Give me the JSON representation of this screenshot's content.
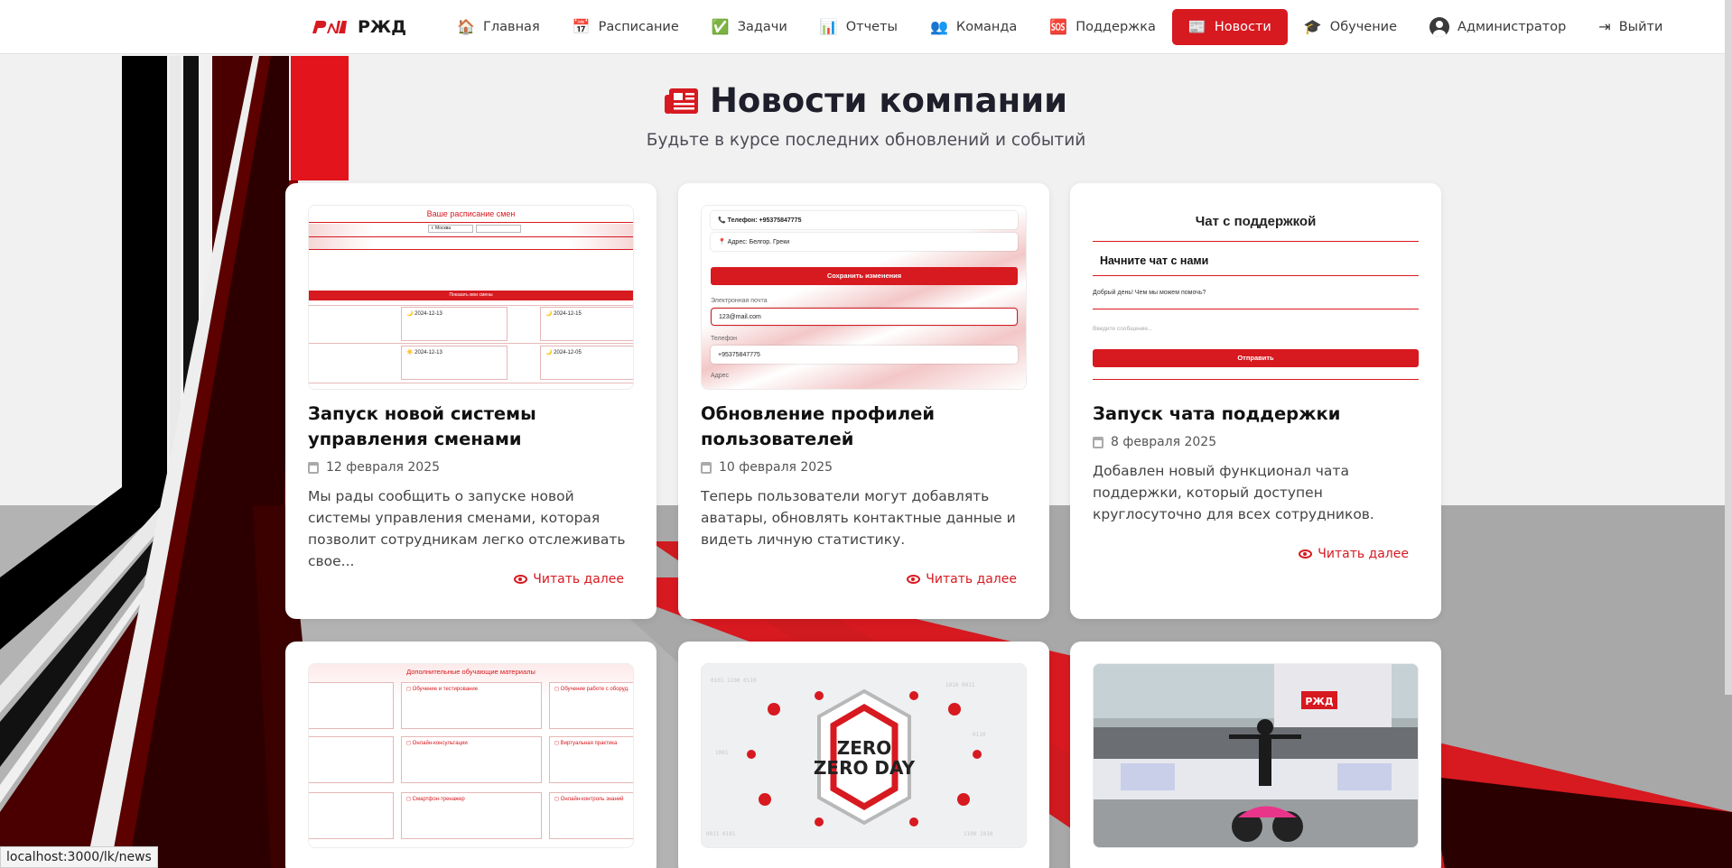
{
  "brand": {
    "logo_text": "РЖД",
    "name": "РЖД"
  },
  "nav": [
    {
      "icon": "home-icon",
      "glyph": "🏠",
      "label": "Главная"
    },
    {
      "icon": "calendar-icon",
      "glyph": "📅",
      "label": "Расписание"
    },
    {
      "icon": "check-icon",
      "glyph": "✅",
      "label": "Задачи"
    },
    {
      "icon": "chart-icon",
      "glyph": "📊",
      "label": "Отчеты"
    },
    {
      "icon": "team-icon",
      "glyph": "👥",
      "label": "Команда"
    },
    {
      "icon": "sos-icon",
      "glyph": "🆘",
      "label": "Поддержка"
    },
    {
      "icon": "news-icon",
      "glyph": "📰",
      "label": "Новости"
    },
    {
      "icon": "graduation-icon",
      "glyph": "🎓",
      "label": "Обучение"
    },
    {
      "icon": "user-icon",
      "glyph": "",
      "label": "Администратор"
    },
    {
      "icon": "logout-icon",
      "glyph": "⇥",
      "label": "Выйти"
    }
  ],
  "active_nav": "Новости",
  "header": {
    "title": "Новости компании",
    "subtitle": "Будьте в курсе последних обновлений и событий"
  },
  "read_more": "Читать далее",
  "cards": [
    {
      "title": "Запуск новой системы управления сменами",
      "date": "12 февраля 2025",
      "text": "Мы рады сообщить о запуске новой системы управления сменами, которая позволит сотрудникам легко отслеживать свое...",
      "thumb": {
        "heading": "Ваше расписание смен",
        "bar": "Показать мои смены",
        "items": [
          "2024-12-13",
          "2024-12-15",
          "2024-12-13",
          "2024-12-05"
        ]
      }
    },
    {
      "title": "Обновление профилей пользователей",
      "date": "10 февраля 2025",
      "text": "Теперь пользователи могут добавлять аватары, обновлять контактные данные и видеть личную статистику.",
      "thumb": {
        "phone": "Телефон: +95375847775",
        "address": "Адрес: Белгор. Греки",
        "save": "Сохранить изменения",
        "email_label": "Электронная почта",
        "email": "123@mail.com",
        "phone_label": "Телефон",
        "phone_value": "+95375847775",
        "address_label": "Адрес"
      }
    },
    {
      "title": "Запуск чата поддержки",
      "date": "8 февраля 2025",
      "text": "Добавлен новый функционал чата поддержки, который доступен круглосуточно для всех сотрудников.",
      "thumb": {
        "heading": "Чат с поддержкой",
        "start": "Начните чат с нами",
        "greeting": "Добрый день! Чем мы можем помочь?",
        "placeholder": "Введите сообщение...",
        "send": "Отправить"
      }
    },
    {
      "thumb": {
        "heading": "Дополнительные обучающие материалы",
        "items": [
          "Обучение и тестирование",
          "Обучение работе с оборуд.",
          "Онлайн-консультации",
          "Виртуальная практика",
          "Смартфон-тренажер",
          "Онлайн-контроль знаний"
        ]
      }
    },
    {
      "thumb": {
        "label": "ZERO DAY"
      }
    },
    {
      "thumb": {
        "label": "РЖД"
      }
    }
  ],
  "status_url": "localhost:3000/lk/news",
  "colors": {
    "accent": "#d71920",
    "dark": "#1f1f2b"
  }
}
